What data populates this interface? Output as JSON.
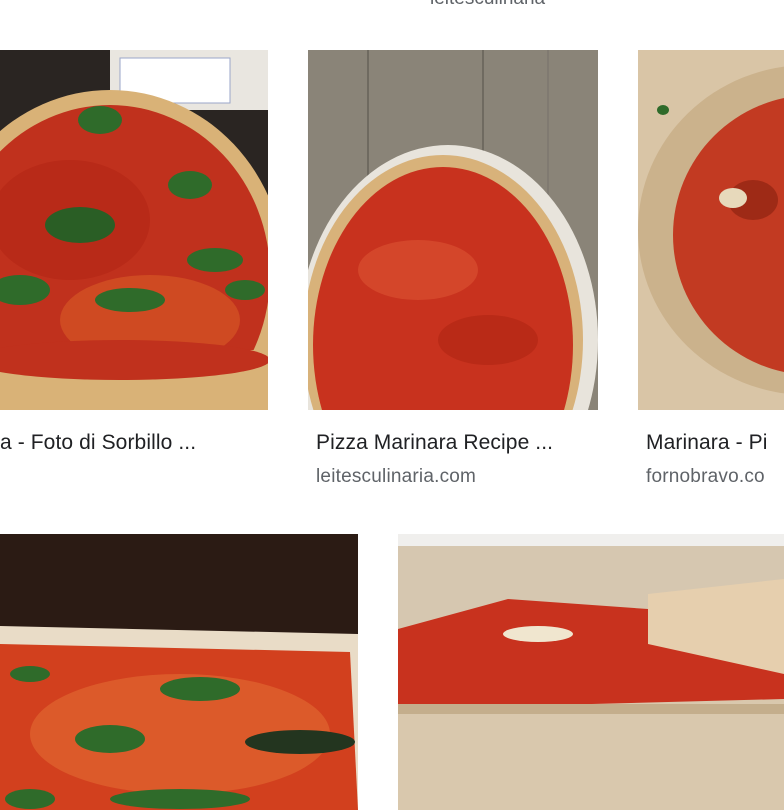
{
  "top_cut_source": "leitesculinaria",
  "results": [
    {
      "caption": "a - Foto di Sorbillo ...",
      "source": ""
    },
    {
      "caption": "Pizza Marinara Recipe ...",
      "source": "leitesculinaria.com"
    },
    {
      "caption": "Marinara - Pi",
      "source": "fornobravo.co"
    },
    {
      "caption": "",
      "source": ""
    },
    {
      "caption": "",
      "source": ""
    }
  ],
  "colors": {
    "sauce": "#c8321e",
    "crust": "#d8b27a",
    "basil": "#2f6b2a",
    "wood": "#8a8478",
    "caption_text": "#202124",
    "source_text": "#5f6368"
  }
}
